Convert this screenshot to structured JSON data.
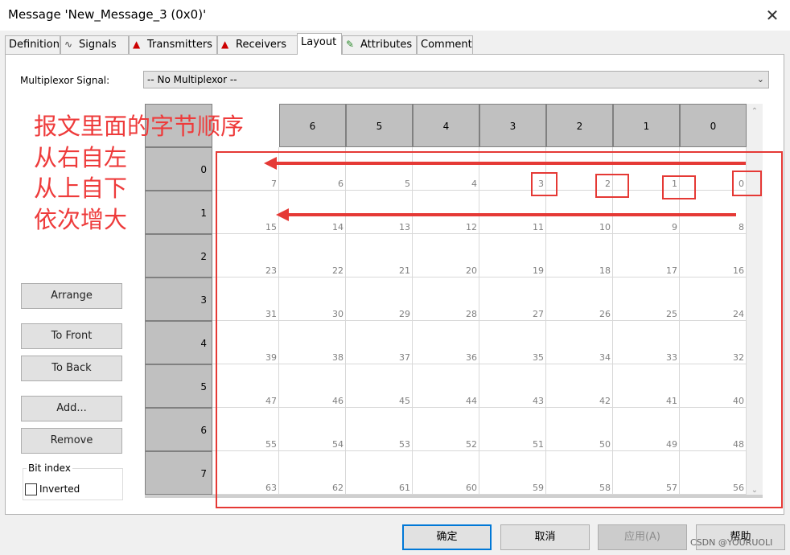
{
  "window": {
    "title": "Message 'New_Message_3 (0x0)'",
    "close_glyph": "✕"
  },
  "tabs": [
    {
      "label": "Definition",
      "icon": ""
    },
    {
      "label": "Signals",
      "icon": "signal-wave-icon"
    },
    {
      "label": "Transmitters",
      "icon": "transmitter-icon"
    },
    {
      "label": "Receivers",
      "icon": "receiver-icon"
    },
    {
      "label": "Layout",
      "icon": ""
    },
    {
      "label": "Attributes",
      "icon": "pencil-icon"
    },
    {
      "label": "Comment",
      "icon": ""
    }
  ],
  "multiplexor": {
    "label": "Multiplexor Signal:",
    "value": "-- No Multiplexor --"
  },
  "buttons": {
    "arrange": "Arrange",
    "to_front": "To Front",
    "to_back": "To Back",
    "add": "Add...",
    "remove": "Remove"
  },
  "bit_index": {
    "legend": "Bit index",
    "inverted_label": "Inverted",
    "inverted_checked": false
  },
  "grid": {
    "column_headers": [
      "6",
      "5",
      "4",
      "3",
      "2",
      "1",
      "0"
    ],
    "row_headers": [
      "0",
      "1",
      "2",
      "3",
      "4",
      "5",
      "6",
      "7"
    ],
    "rows": [
      [
        "7",
        "6",
        "5",
        "4",
        "3",
        "2",
        "1",
        "0"
      ],
      [
        "15",
        "14",
        "13",
        "12",
        "11",
        "10",
        "9",
        "8"
      ],
      [
        "23",
        "22",
        "21",
        "20",
        "19",
        "18",
        "17",
        "16"
      ],
      [
        "31",
        "30",
        "29",
        "28",
        "27",
        "26",
        "25",
        "24"
      ],
      [
        "39",
        "38",
        "37",
        "36",
        "35",
        "34",
        "33",
        "32"
      ],
      [
        "47",
        "46",
        "45",
        "44",
        "43",
        "42",
        "41",
        "40"
      ],
      [
        "55",
        "54",
        "53",
        "52",
        "51",
        "50",
        "49",
        "48"
      ],
      [
        "63",
        "62",
        "61",
        "60",
        "59",
        "58",
        "57",
        "56"
      ]
    ]
  },
  "annotation": {
    "lines": [
      "报文里面的字节顺序",
      "从右自左",
      "从上自下",
      "依次增大"
    ],
    "color": "#e53935"
  },
  "dialog_buttons": {
    "ok": "确定",
    "cancel": "取消",
    "apply": "应用(A)",
    "help": "帮助"
  },
  "watermark": "CSDN @YOURUOLI",
  "colors": {
    "header_gray": "#c0c0c0",
    "accent_blue": "#0078d7",
    "annotation_red": "#e53935"
  }
}
